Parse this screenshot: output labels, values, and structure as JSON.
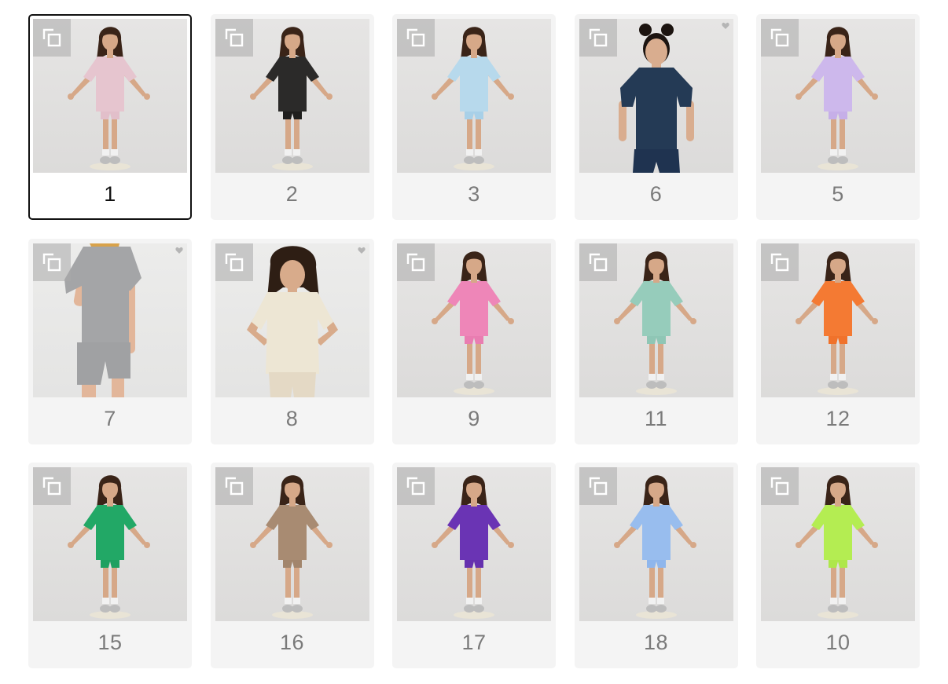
{
  "swatches": [
    {
      "label": "1",
      "shirt": "#e6c5cf",
      "shorts": "#e2bfca",
      "pose": "tpose",
      "selected": true
    },
    {
      "label": "2",
      "shirt": "#2b2a29",
      "shorts": "#1f1e1d",
      "pose": "tpose"
    },
    {
      "label": "3",
      "shirt": "#b7d9ec",
      "shorts": "#a8d0e8",
      "pose": "tpose"
    },
    {
      "label": "6",
      "shirt": "#243a55",
      "shorts": "#1f3350",
      "pose": "closeup",
      "favorite": true
    },
    {
      "label": "5",
      "shirt": "#cdb8ec",
      "shorts": "#c6afe8",
      "pose": "tpose"
    },
    {
      "label": "7",
      "shirt": "#a4a5a7",
      "shorts": "#a0a1a3",
      "pose": "cropped",
      "favorite": true
    },
    {
      "label": "8",
      "shirt": "#ede6d4",
      "shorts": "#e4d9c5",
      "pose": "hips",
      "favorite": true
    },
    {
      "label": "9",
      "shirt": "#ee86b8",
      "shorts": "#e97db1",
      "pose": "tpose"
    },
    {
      "label": "11",
      "shirt": "#96ccbb",
      "shorts": "#8fc6b5",
      "pose": "tpose"
    },
    {
      "label": "12",
      "shirt": "#f47a33",
      "shorts": "#f0722b",
      "pose": "tpose"
    },
    {
      "label": "15",
      "shirt": "#22a866",
      "shorts": "#1fa060",
      "pose": "tpose"
    },
    {
      "label": "16",
      "shirt": "#a88b72",
      "shorts": "#a2856c",
      "pose": "tpose"
    },
    {
      "label": "17",
      "shirt": "#6a34b4",
      "shorts": "#6530ae",
      "pose": "tpose"
    },
    {
      "label": "18",
      "shirt": "#98bdee",
      "shorts": "#8fb6ec",
      "pose": "tpose"
    },
    {
      "label": "10",
      "shirt": "#b4ed52",
      "shorts": "#aee74a",
      "pose": "tpose"
    }
  ],
  "icons": {
    "zoom": "zoom-square-icon",
    "favorite": "heart-icon"
  },
  "colors": {
    "selected_border": "#111111",
    "tile_background": "#f4f4f4",
    "label_text": "#7a7a7a"
  }
}
